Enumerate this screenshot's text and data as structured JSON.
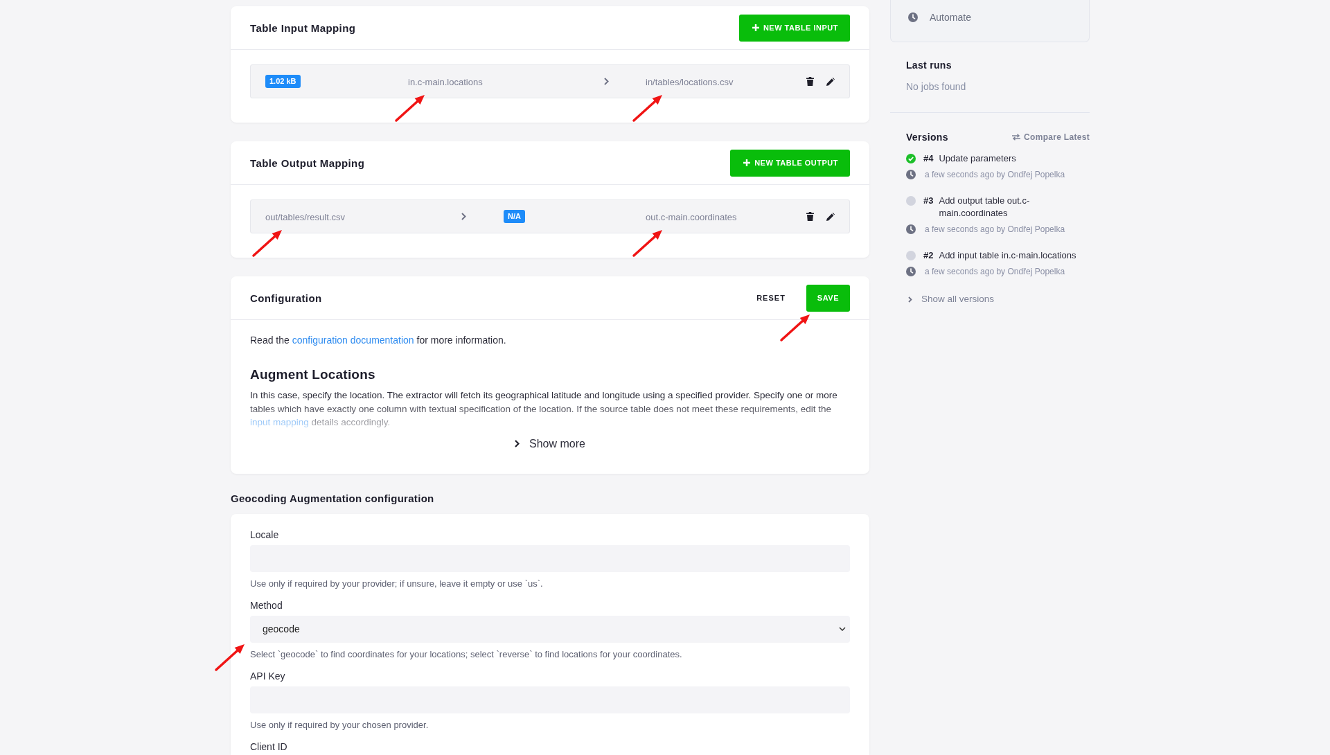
{
  "mappings": [
    {
      "kind": "input",
      "title": "Table Input Mapping",
      "button": "NEW TABLE INPUT",
      "rows": [
        {
          "size": "1.02 kB",
          "source": {
            "text": "in.c-main.locations",
            "annotated": true
          },
          "destination": {
            "text": "in/tables/locations.csv",
            "annotated": true
          }
        }
      ]
    },
    {
      "kind": "output",
      "title": "Table Output Mapping",
      "button": "NEW TABLE OUTPUT",
      "rows": [
        {
          "source": {
            "text": "out/tables/result.csv",
            "annotated": true
          },
          "size": "N/A",
          "destination": {
            "text": "out.c-main.coordinates",
            "annotated": true
          }
        }
      ]
    }
  ],
  "configuration": {
    "title": "Configuration",
    "reset_button": "RESET",
    "save_button": {
      "label": "SAVE",
      "annotated": true
    },
    "intro": {
      "before": "Read the ",
      "link": "configuration documentation",
      "after": " for more information."
    },
    "heading": "Augment Locations",
    "description": {
      "before": "In this case, specify the location. The extractor will fetch its geographical latitude and longitude using a specified provider. Specify one or more tables which have exactly one column with textual specification of the location. If the source table does not meet these requirements, edit the ",
      "link": "input mapping",
      "after": " details accordingly."
    },
    "show_more": "Show more"
  },
  "geocoding": {
    "title": "Geocoding Augmentation configuration",
    "fields": [
      {
        "kind": "text",
        "label": "Locale",
        "help": "Use only if required by your provider; if unsure, leave it empty or use `us`.",
        "annotated": false
      },
      {
        "kind": "select",
        "label": "Method",
        "value": "geocode",
        "help": "Select `geocode` to find coordinates for your locations; select `reverse` to find locations for your coordinates.",
        "annotated": true
      },
      {
        "kind": "text",
        "label": "API Key",
        "help": "Use only if required by your chosen provider.",
        "annotated": false
      },
      {
        "kind": "label",
        "label": "Client ID",
        "annotated": false
      }
    ]
  },
  "sidebar": {
    "actions": [
      {
        "label": "Automate"
      }
    ],
    "last_runs": {
      "title": "Last runs",
      "empty": "No jobs found"
    },
    "versions": {
      "title": "Versions",
      "compare": "Compare Latest",
      "items": [
        {
          "number": "#4",
          "title": "Update parameters",
          "meta": "a few seconds ago by Ondřej Popelka",
          "active": true
        },
        {
          "number": "#3",
          "title": "Add output table out.c-main.coordinates",
          "meta": "a few seconds ago by Ondřej Popelka",
          "active": false
        },
        {
          "number": "#2",
          "title": "Add input table in.c-main.locations",
          "meta": "a few seconds ago by Ondřej Popelka",
          "active": false
        }
      ],
      "show_all": "Show all versions"
    }
  }
}
